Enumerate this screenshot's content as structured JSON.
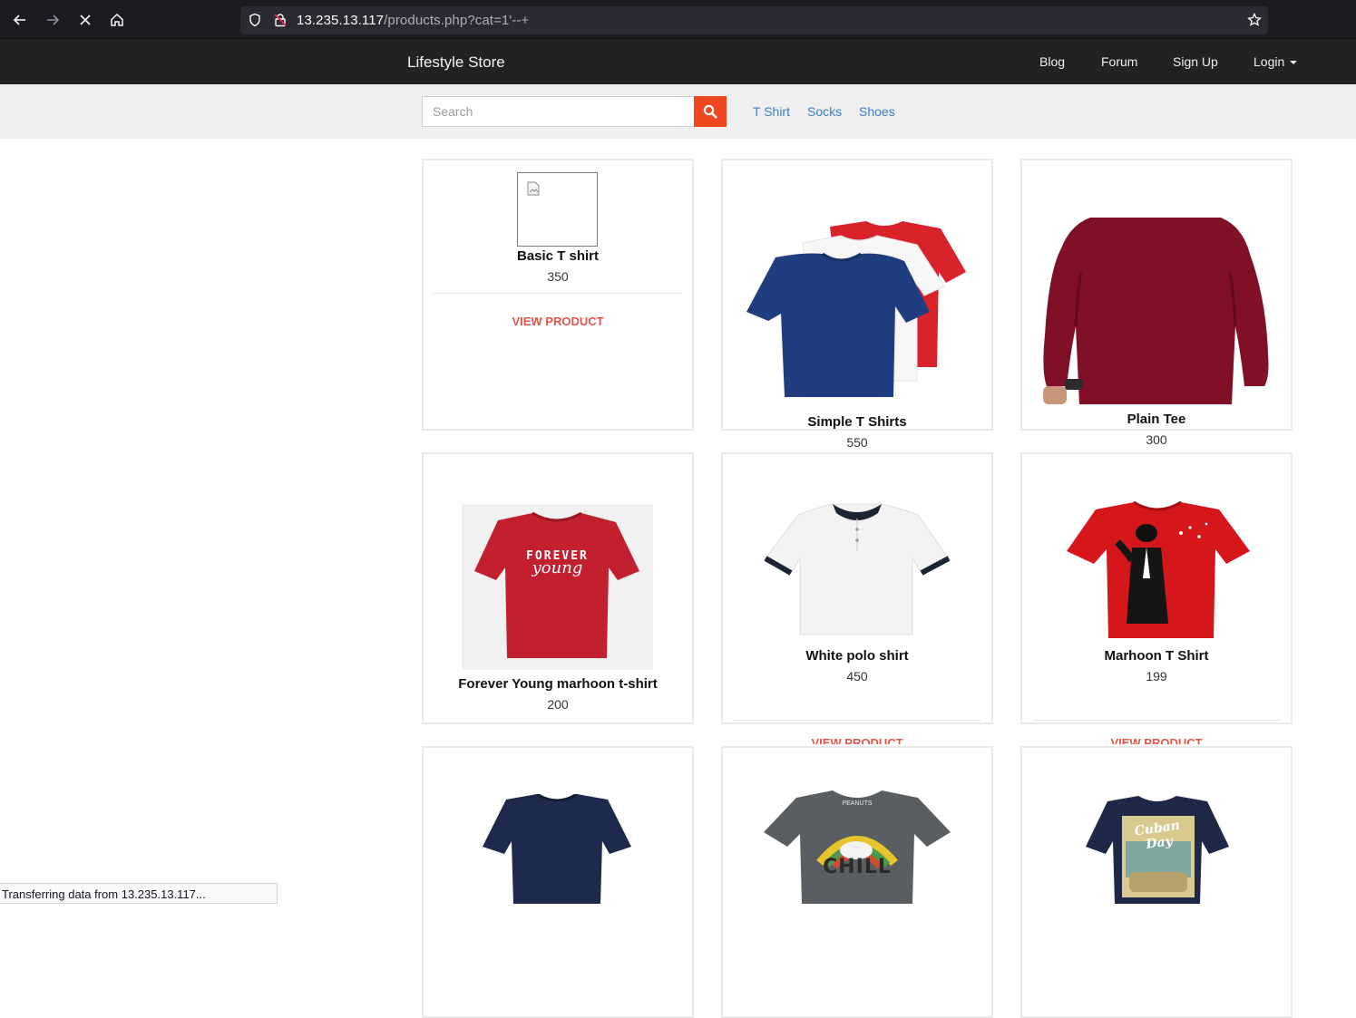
{
  "browser": {
    "url_host": "13.235.13.117",
    "url_path": "/products.php?cat=1'--+",
    "status_text": "Transferring data from 13.235.13.117..."
  },
  "header": {
    "brand": "Lifestyle Store",
    "nav": [
      "Blog",
      "Forum",
      "Sign Up",
      "Login"
    ]
  },
  "search": {
    "placeholder": "Search",
    "categories": [
      "T Shirt",
      "Socks",
      "Shoes"
    ]
  },
  "products": [
    {
      "name": "Basic T shirt",
      "price": "350",
      "action": "VIEW PRODUCT",
      "image": "broken-image"
    },
    {
      "name": "Simple T Shirts",
      "price": "550",
      "image": "stacked-tshirts"
    },
    {
      "name": "Plain Tee",
      "price": "300",
      "image": "maroon-long-sleeve"
    },
    {
      "name": "Forever Young marhoon t-shirt",
      "price": "200",
      "image": "red-tshirt-print",
      "print_line1": "FOREVER",
      "print_line2": "young"
    },
    {
      "name": "White polo shirt",
      "price": "450",
      "action": "VIEW PRODUCT",
      "image": "white-polo"
    },
    {
      "name": "Marhoon T Shirt",
      "price": "199",
      "action": "VIEW PRODUCT",
      "image": "red-tshirt-graphic"
    },
    {
      "image": "navy-tshirt"
    },
    {
      "image": "grey-chill-tshirt",
      "print_top": "PEANUTS",
      "print_text": "CHILL"
    },
    {
      "image": "navy-cuban-tshirt",
      "print_text": "Cuban Day"
    }
  ],
  "colors": {
    "accent": "#f0471f",
    "header_bg": "#222222",
    "link": "#3c7fbf",
    "view_link": "#e2574c"
  }
}
